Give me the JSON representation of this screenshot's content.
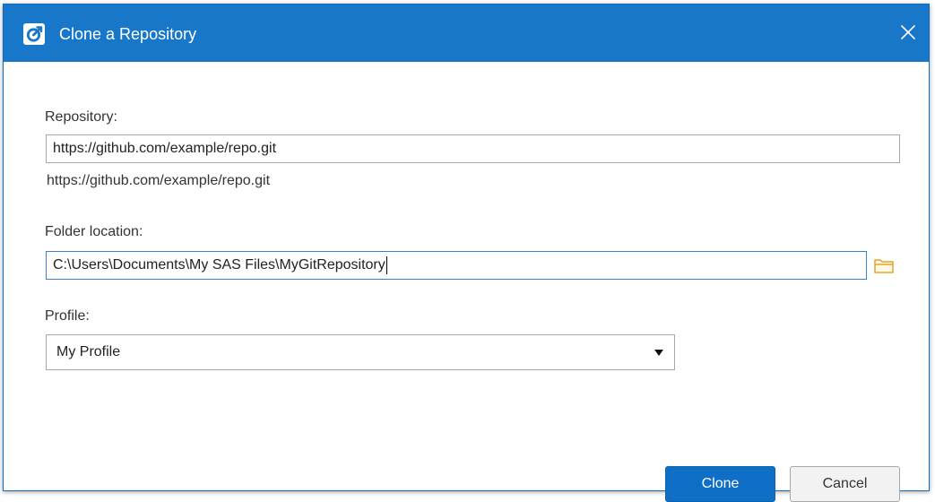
{
  "window": {
    "title": "Clone a Repository",
    "app_icon": "sas-studio-logo-icon",
    "close_icon": "close-icon"
  },
  "repository": {
    "label": "Repository:",
    "value": "https://github.com/example/repo.git",
    "resolved_url": "https://github.com/example/repo.git"
  },
  "folder": {
    "label": "Folder location:",
    "value": "C:\\Users\\Documents\\My SAS Files\\MyGitRepository",
    "browse_icon": "folder-icon"
  },
  "profile": {
    "label": "Profile:",
    "selected": "My Profile",
    "dropdown_icon": "dropdown-arrow-icon"
  },
  "buttons": {
    "clone_label": "Clone",
    "cancel_label": "Cancel"
  },
  "colors": {
    "titlebar": "#1877c9",
    "primary_button": "#0f6fc6",
    "folder_icon": "#e8b33b"
  }
}
